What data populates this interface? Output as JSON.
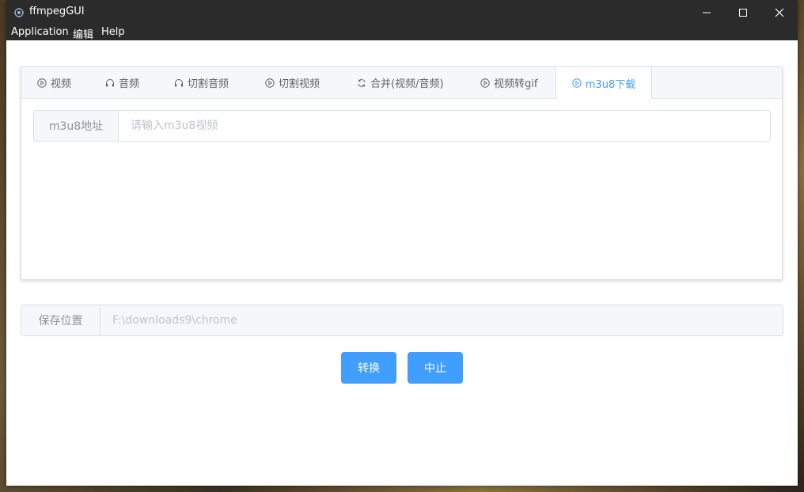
{
  "window": {
    "title": "ffmpegGUI",
    "controls": [
      "minimize-icon",
      "maximize-icon",
      "close-icon"
    ]
  },
  "menu": [
    "Application",
    "编辑",
    "Help"
  ],
  "tabs": [
    {
      "label": "视频",
      "icon": "play-circle-icon",
      "active": false
    },
    {
      "label": "音频",
      "icon": "headset-icon",
      "active": false
    },
    {
      "label": "切割音频",
      "icon": "headset-icon",
      "active": false
    },
    {
      "label": "切割视频",
      "icon": "play-circle-icon",
      "active": false
    },
    {
      "label": "合并(视频/音频)",
      "icon": "refresh-icon",
      "active": false
    },
    {
      "label": "视频转gif",
      "icon": "play-circle-icon",
      "active": false
    },
    {
      "label": "m3u8下载",
      "icon": "play-circle-icon",
      "active": true
    }
  ],
  "m3u8": {
    "label": "m3u8地址",
    "placeholder": "请输入m3u8视频",
    "value": ""
  },
  "save": {
    "label": "保存位置",
    "value": "F:\\downloads9\\chrome"
  },
  "buttons": {
    "convert": "转换",
    "stop": "中止"
  },
  "colors": {
    "accent": "#409eff",
    "titlebar": "#2b2b2b"
  }
}
